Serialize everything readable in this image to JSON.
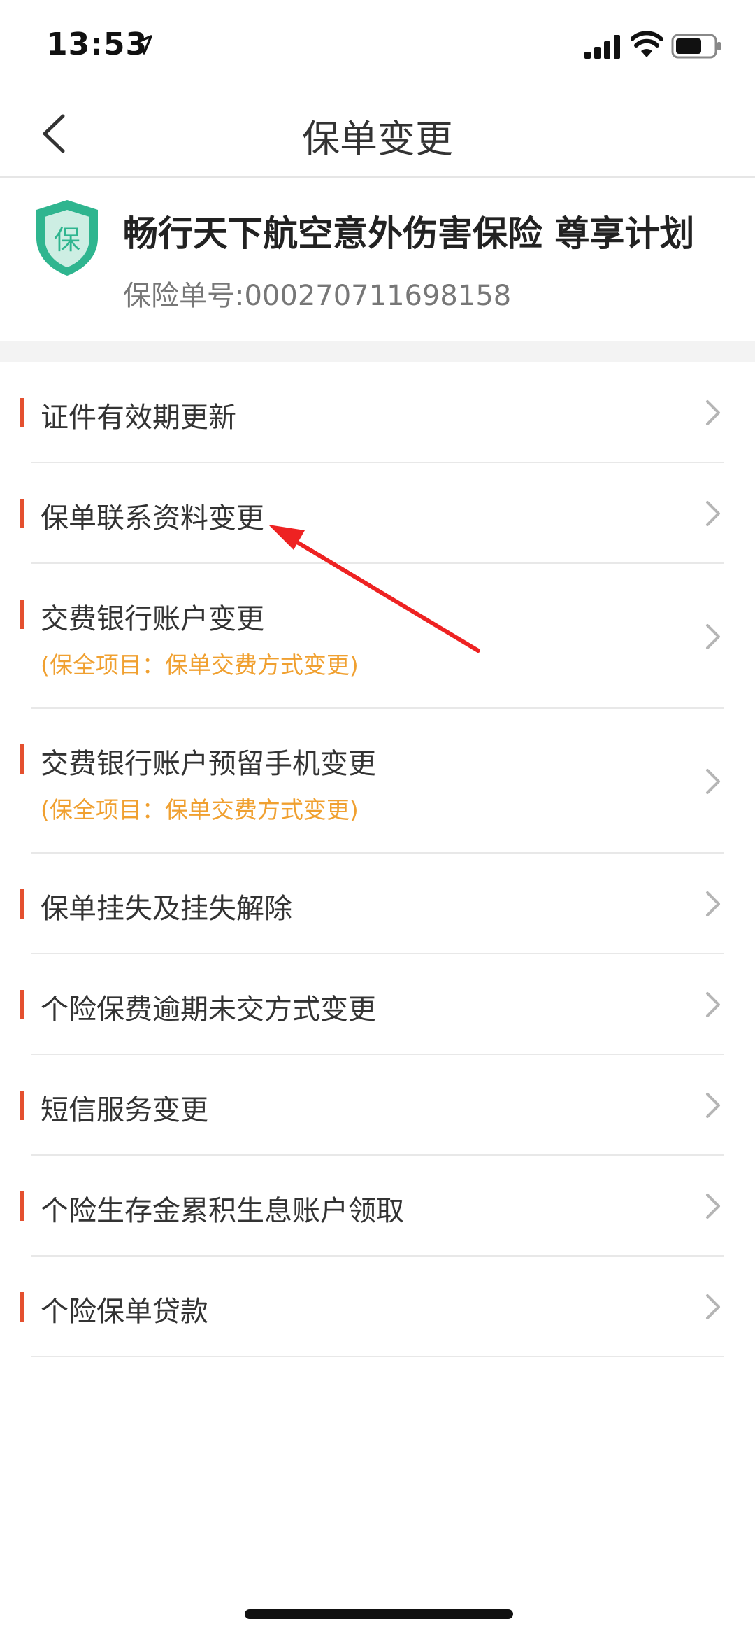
{
  "status_bar": {
    "time": "13:53"
  },
  "nav": {
    "title": "保单变更"
  },
  "policy": {
    "name": "畅行天下航空意外伤害保险 尊享计划",
    "number": "保险单号:000270711698158",
    "badge_char": "保"
  },
  "menu": {
    "items": [
      {
        "label": "证件有效期更新"
      },
      {
        "label": "保单联系资料变更"
      },
      {
        "label": "交费银行账户变更",
        "sub": "(保全项目：保单交费方式变更)"
      },
      {
        "label": "交费银行账户预留手机变更",
        "sub": "(保全项目：保单交费方式变更)"
      },
      {
        "label": "保单挂失及挂失解除"
      },
      {
        "label": "个险保费逾期未交方式变更"
      },
      {
        "label": "短信服务变更"
      },
      {
        "label": "个险生存金累积生息账户领取"
      },
      {
        "label": "个险保单贷款"
      }
    ]
  },
  "colors": {
    "accent": "#e4502f",
    "sub_text": "#f0a030",
    "shield": "#2fb58f",
    "annotation": "#ee2222"
  },
  "icons": [
    "location-arrow-icon",
    "signal-icon",
    "wifi-icon",
    "battery-icon",
    "back-chevron-icon",
    "shield-icon",
    "chevron-right-icon"
  ]
}
